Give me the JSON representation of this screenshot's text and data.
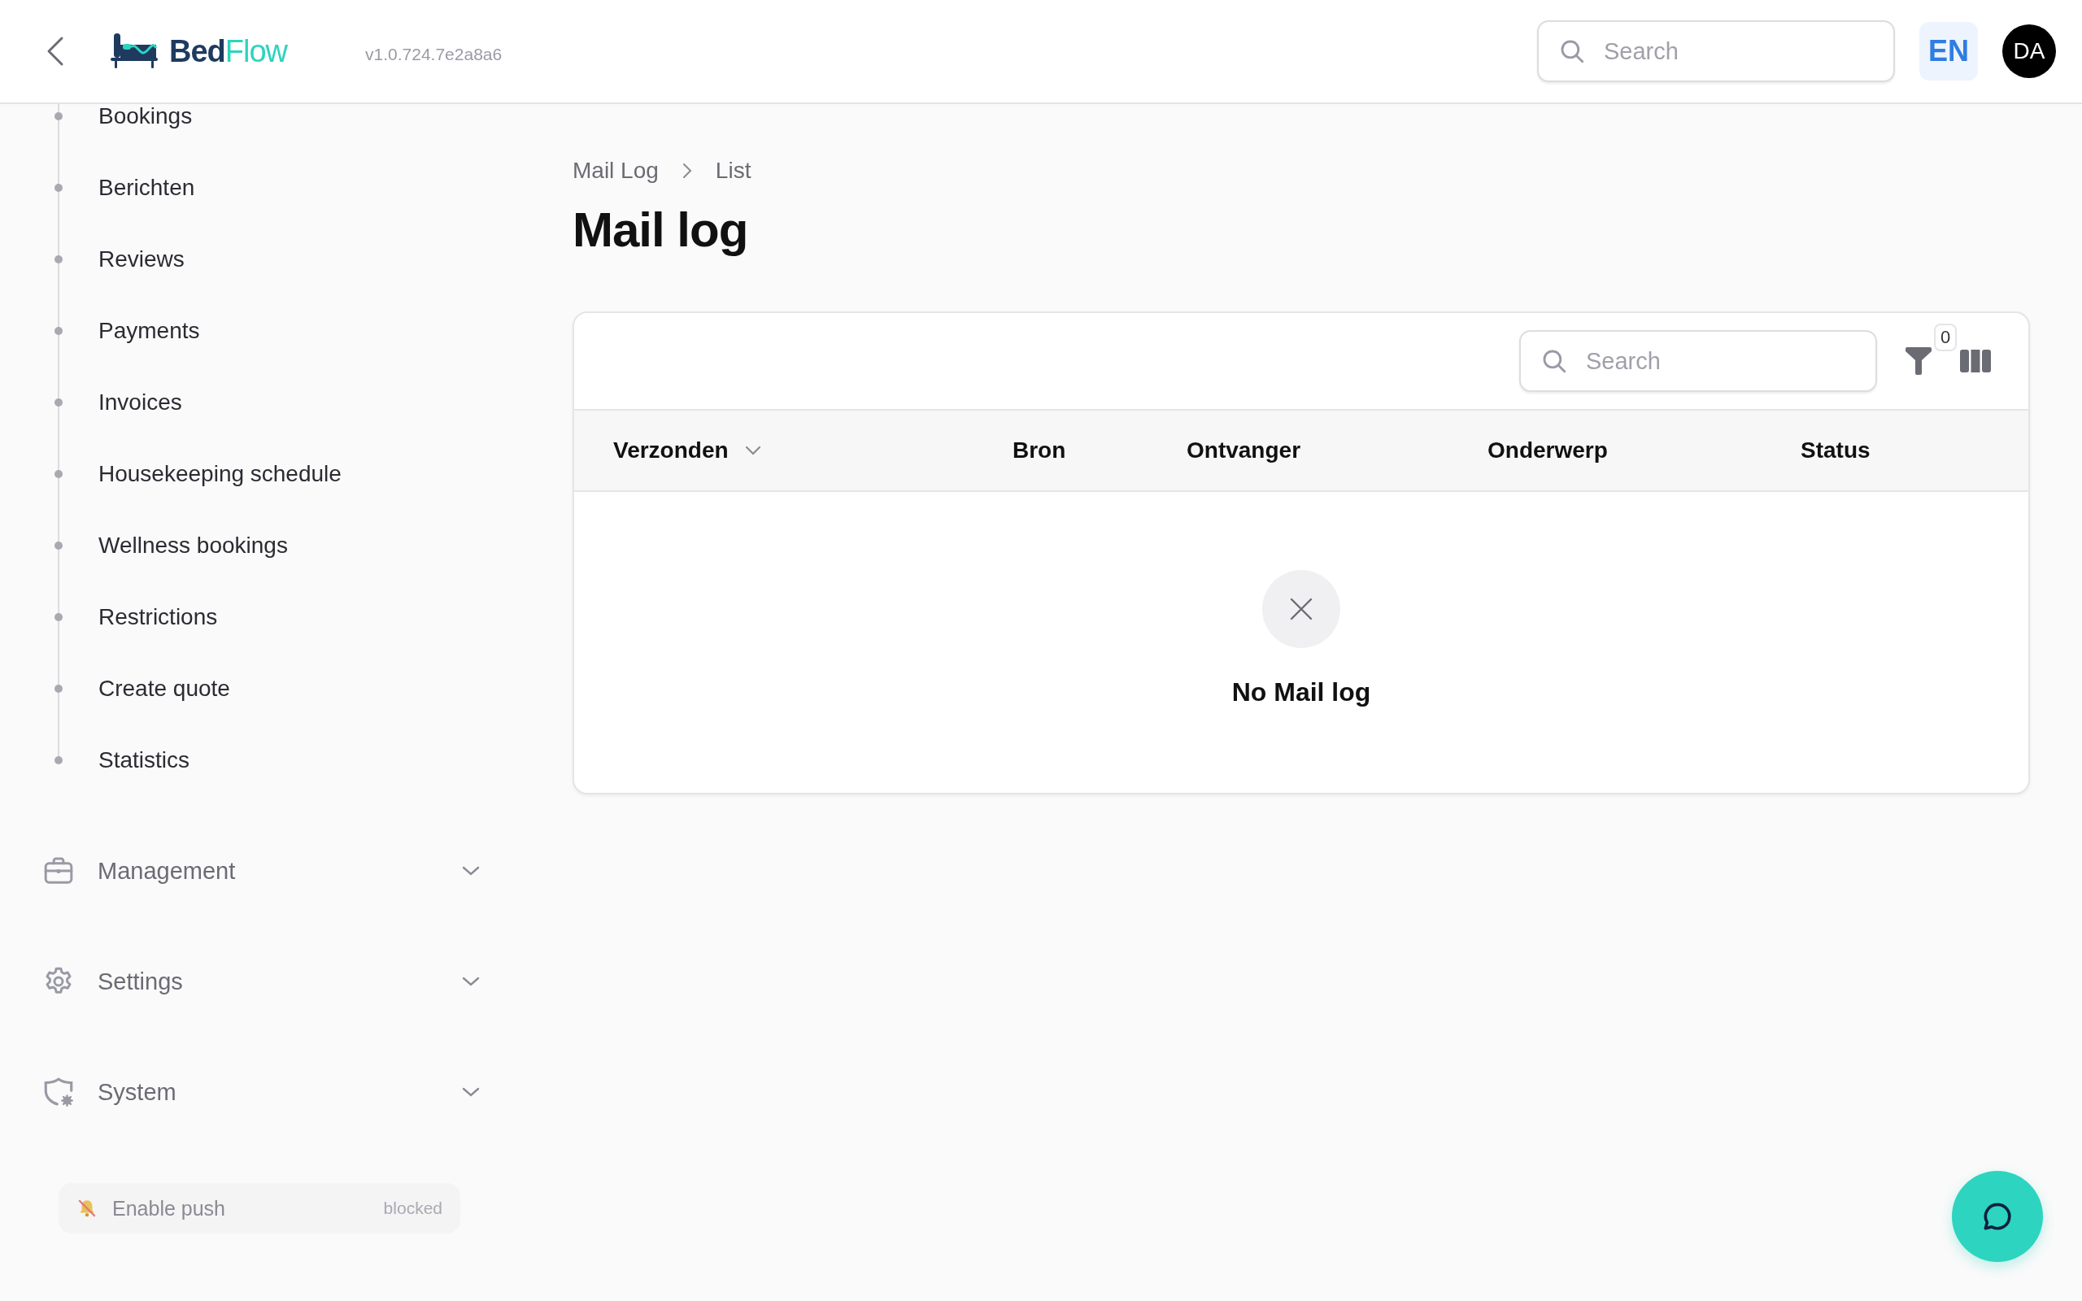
{
  "header": {
    "logo": {
      "part_1": "Bed",
      "part_2": "Flow"
    },
    "version": "v1.0.724.7e2a8a6",
    "search": {
      "placeholder": "Search"
    },
    "language": "EN",
    "avatar": "DA"
  },
  "sidebar": {
    "items": [
      {
        "label": "Bookings"
      },
      {
        "label": "Berichten"
      },
      {
        "label": "Reviews"
      },
      {
        "label": "Payments"
      },
      {
        "label": "Invoices"
      },
      {
        "label": "Housekeeping schedule"
      },
      {
        "label": "Wellness bookings"
      },
      {
        "label": "Restrictions"
      },
      {
        "label": "Create quote"
      },
      {
        "label": "Statistics"
      }
    ],
    "groups": [
      {
        "label": "Management",
        "kind": "briefcase",
        "expanded": false
      },
      {
        "label": "Settings",
        "kind": "gear",
        "expanded": false
      },
      {
        "label": "System",
        "kind": "shield",
        "expanded": false
      }
    ],
    "push": {
      "label": "Enable push",
      "status": "blocked"
    }
  },
  "breadcrumb": [
    {
      "label": "Mail Log"
    },
    {
      "label": "List"
    }
  ],
  "title": "Mail log",
  "table": {
    "search": {
      "placeholder": "Search"
    },
    "filter_count": "0",
    "columns": [
      {
        "label": "Verzonden",
        "sorted": true
      },
      {
        "label": "Bron",
        "sorted": false
      },
      {
        "label": "Ontvanger",
        "sorted": false
      },
      {
        "label": "Onderwerp",
        "sorted": false
      },
      {
        "label": "Status",
        "sorted": false
      }
    ],
    "empty_message": "No Mail log"
  }
}
